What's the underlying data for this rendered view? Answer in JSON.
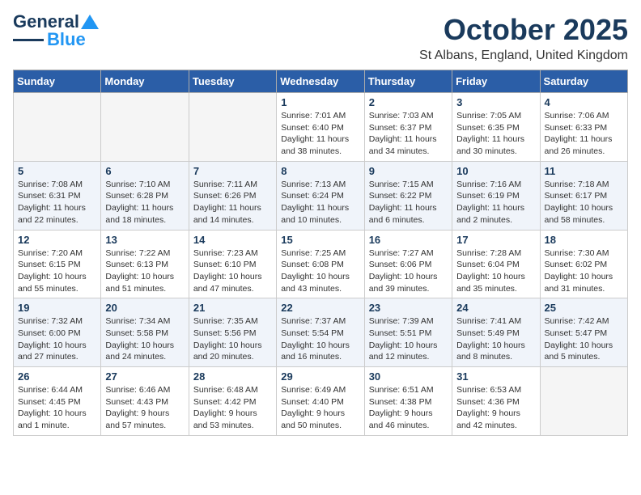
{
  "logo": {
    "line1": "General",
    "line2": "Blue"
  },
  "header": {
    "month": "October 2025",
    "location": "St Albans, England, United Kingdom"
  },
  "days_of_week": [
    "Sunday",
    "Monday",
    "Tuesday",
    "Wednesday",
    "Thursday",
    "Friday",
    "Saturday"
  ],
  "weeks": [
    [
      {
        "day": "",
        "info": ""
      },
      {
        "day": "",
        "info": ""
      },
      {
        "day": "",
        "info": ""
      },
      {
        "day": "1",
        "info": "Sunrise: 7:01 AM\nSunset: 6:40 PM\nDaylight: 11 hours\nand 38 minutes."
      },
      {
        "day": "2",
        "info": "Sunrise: 7:03 AM\nSunset: 6:37 PM\nDaylight: 11 hours\nand 34 minutes."
      },
      {
        "day": "3",
        "info": "Sunrise: 7:05 AM\nSunset: 6:35 PM\nDaylight: 11 hours\nand 30 minutes."
      },
      {
        "day": "4",
        "info": "Sunrise: 7:06 AM\nSunset: 6:33 PM\nDaylight: 11 hours\nand 26 minutes."
      }
    ],
    [
      {
        "day": "5",
        "info": "Sunrise: 7:08 AM\nSunset: 6:31 PM\nDaylight: 11 hours\nand 22 minutes."
      },
      {
        "day": "6",
        "info": "Sunrise: 7:10 AM\nSunset: 6:28 PM\nDaylight: 11 hours\nand 18 minutes."
      },
      {
        "day": "7",
        "info": "Sunrise: 7:11 AM\nSunset: 6:26 PM\nDaylight: 11 hours\nand 14 minutes."
      },
      {
        "day": "8",
        "info": "Sunrise: 7:13 AM\nSunset: 6:24 PM\nDaylight: 11 hours\nand 10 minutes."
      },
      {
        "day": "9",
        "info": "Sunrise: 7:15 AM\nSunset: 6:22 PM\nDaylight: 11 hours\nand 6 minutes."
      },
      {
        "day": "10",
        "info": "Sunrise: 7:16 AM\nSunset: 6:19 PM\nDaylight: 11 hours\nand 2 minutes."
      },
      {
        "day": "11",
        "info": "Sunrise: 7:18 AM\nSunset: 6:17 PM\nDaylight: 10 hours\nand 58 minutes."
      }
    ],
    [
      {
        "day": "12",
        "info": "Sunrise: 7:20 AM\nSunset: 6:15 PM\nDaylight: 10 hours\nand 55 minutes."
      },
      {
        "day": "13",
        "info": "Sunrise: 7:22 AM\nSunset: 6:13 PM\nDaylight: 10 hours\nand 51 minutes."
      },
      {
        "day": "14",
        "info": "Sunrise: 7:23 AM\nSunset: 6:10 PM\nDaylight: 10 hours\nand 47 minutes."
      },
      {
        "day": "15",
        "info": "Sunrise: 7:25 AM\nSunset: 6:08 PM\nDaylight: 10 hours\nand 43 minutes."
      },
      {
        "day": "16",
        "info": "Sunrise: 7:27 AM\nSunset: 6:06 PM\nDaylight: 10 hours\nand 39 minutes."
      },
      {
        "day": "17",
        "info": "Sunrise: 7:28 AM\nSunset: 6:04 PM\nDaylight: 10 hours\nand 35 minutes."
      },
      {
        "day": "18",
        "info": "Sunrise: 7:30 AM\nSunset: 6:02 PM\nDaylight: 10 hours\nand 31 minutes."
      }
    ],
    [
      {
        "day": "19",
        "info": "Sunrise: 7:32 AM\nSunset: 6:00 PM\nDaylight: 10 hours\nand 27 minutes."
      },
      {
        "day": "20",
        "info": "Sunrise: 7:34 AM\nSunset: 5:58 PM\nDaylight: 10 hours\nand 24 minutes."
      },
      {
        "day": "21",
        "info": "Sunrise: 7:35 AM\nSunset: 5:56 PM\nDaylight: 10 hours\nand 20 minutes."
      },
      {
        "day": "22",
        "info": "Sunrise: 7:37 AM\nSunset: 5:54 PM\nDaylight: 10 hours\nand 16 minutes."
      },
      {
        "day": "23",
        "info": "Sunrise: 7:39 AM\nSunset: 5:51 PM\nDaylight: 10 hours\nand 12 minutes."
      },
      {
        "day": "24",
        "info": "Sunrise: 7:41 AM\nSunset: 5:49 PM\nDaylight: 10 hours\nand 8 minutes."
      },
      {
        "day": "25",
        "info": "Sunrise: 7:42 AM\nSunset: 5:47 PM\nDaylight: 10 hours\nand 5 minutes."
      }
    ],
    [
      {
        "day": "26",
        "info": "Sunrise: 6:44 AM\nSunset: 4:45 PM\nDaylight: 10 hours\nand 1 minute."
      },
      {
        "day": "27",
        "info": "Sunrise: 6:46 AM\nSunset: 4:43 PM\nDaylight: 9 hours\nand 57 minutes."
      },
      {
        "day": "28",
        "info": "Sunrise: 6:48 AM\nSunset: 4:42 PM\nDaylight: 9 hours\nand 53 minutes."
      },
      {
        "day": "29",
        "info": "Sunrise: 6:49 AM\nSunset: 4:40 PM\nDaylight: 9 hours\nand 50 minutes."
      },
      {
        "day": "30",
        "info": "Sunrise: 6:51 AM\nSunset: 4:38 PM\nDaylight: 9 hours\nand 46 minutes."
      },
      {
        "day": "31",
        "info": "Sunrise: 6:53 AM\nSunset: 4:36 PM\nDaylight: 9 hours\nand 42 minutes."
      },
      {
        "day": "",
        "info": ""
      }
    ]
  ]
}
